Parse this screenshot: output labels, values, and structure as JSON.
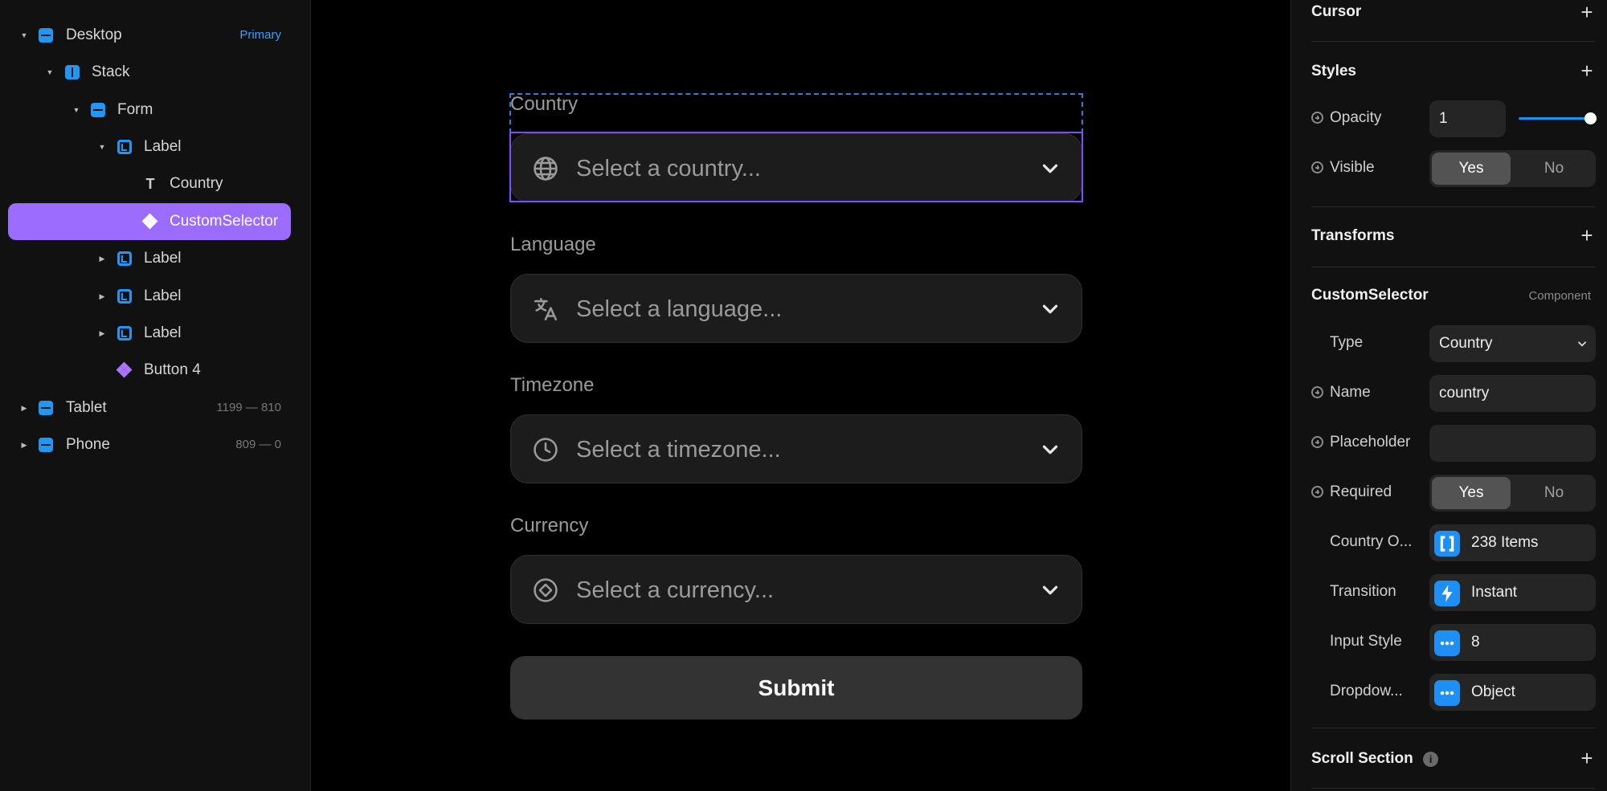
{
  "layers": [
    {
      "label": "Desktop",
      "meta": "Primary",
      "icon": "stack-vertical-icon",
      "expanded": true
    },
    {
      "label": "Stack",
      "icon": "stack-horizontal-icon",
      "expanded": true
    },
    {
      "label": "Form",
      "icon": "stack-vertical-icon",
      "expanded": true
    },
    {
      "label": "Label",
      "icon": "label-icon",
      "expanded": true
    },
    {
      "label": "Country",
      "icon": "text-icon"
    },
    {
      "label": "CustomSelector",
      "icon": "component-icon",
      "selected": true
    },
    {
      "label": "Label",
      "icon": "label-icon",
      "expanded": false
    },
    {
      "label": "Label",
      "icon": "label-icon",
      "expanded": false
    },
    {
      "label": "Label",
      "icon": "label-icon",
      "expanded": false
    },
    {
      "label": "Button 4",
      "icon": "component-icon"
    },
    {
      "label": "Tablet",
      "meta": "1199 — 810",
      "icon": "stack-vertical-icon",
      "expanded": false
    },
    {
      "label": "Phone",
      "meta": "809 — 0",
      "icon": "stack-vertical-icon",
      "expanded": false
    }
  ],
  "form": {
    "fields": [
      {
        "label": "Country",
        "placeholder": "Select a country...",
        "icon": "globe-icon"
      },
      {
        "label": "Language",
        "placeholder": "Select a language...",
        "icon": "translate-icon"
      },
      {
        "label": "Timezone",
        "placeholder": "Select a timezone...",
        "icon": "clock-icon"
      },
      {
        "label": "Currency",
        "placeholder": "Select a currency...",
        "icon": "currency-icon"
      }
    ],
    "submit_label": "Submit"
  },
  "props": {
    "cursor": {
      "title": "Cursor"
    },
    "styles": {
      "title": "Styles",
      "opacity_label": "Opacity",
      "opacity_value": "1",
      "opacity_slider": 1.0,
      "visible_label": "Visible",
      "yes": "Yes",
      "no": "No"
    },
    "transforms": {
      "title": "Transforms"
    },
    "component": {
      "title": "CustomSelector",
      "kind": "Component",
      "type_label": "Type",
      "type_value": "Country",
      "name_label": "Name",
      "name_value": "country",
      "placeholder_label": "Placeholder",
      "placeholder_value": "",
      "required_label": "Required",
      "yes": "Yes",
      "no": "No",
      "options_label": "Country O...",
      "options_value": "238 Items",
      "transition_label": "Transition",
      "transition_value": "Instant",
      "input_style_label": "Input Style",
      "input_style_value": "8",
      "dropdown_label": "Dropdow...",
      "dropdown_value": "Object"
    },
    "scroll": {
      "title": "Scroll Section"
    }
  },
  "colors": {
    "accent_purple": "#9b6cff",
    "accent_blue": "#2196f3",
    "selection_border": "#7d4dff"
  }
}
